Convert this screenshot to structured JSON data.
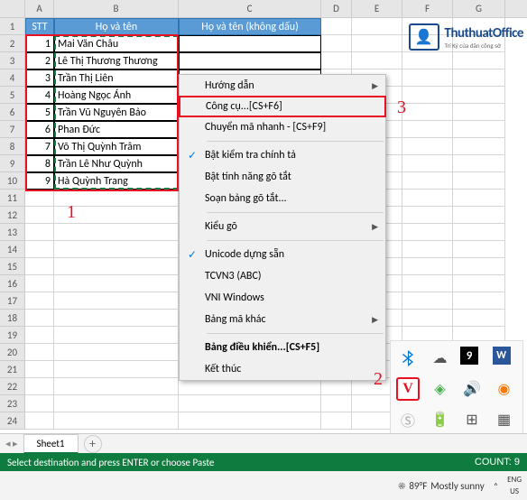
{
  "columns": [
    "A",
    "B",
    "C",
    "D",
    "E",
    "F",
    "G"
  ],
  "header": {
    "stt": "STT",
    "name": "Họ và tên",
    "name_nd": "Họ và tên (không dấu)"
  },
  "rows": [
    {
      "n": "1",
      "name": "Mai Văn Châu"
    },
    {
      "n": "2",
      "name": "Lê Thị Thương Thương"
    },
    {
      "n": "3",
      "name": "Trần Thị Liên"
    },
    {
      "n": "4",
      "name": "Hoàng Ngọc Ánh"
    },
    {
      "n": "5",
      "name": "Trần Vũ Nguyên Bảo"
    },
    {
      "n": "6",
      "name": "Phan Đức"
    },
    {
      "n": "7",
      "name": "Võ Thị Quỳnh Trâm"
    },
    {
      "n": "8",
      "name": "Trần Lê Như Quỳnh"
    },
    {
      "n": "9",
      "name": "Hà Quỳnh Trang"
    }
  ],
  "row_numbers": [
    "1",
    "2",
    "3",
    "4",
    "5",
    "6",
    "7",
    "8",
    "9",
    "10",
    "11",
    "12",
    "13",
    "14",
    "15",
    "16",
    "17",
    "18",
    "19",
    "20",
    "21",
    "22",
    "23",
    "24"
  ],
  "logo": {
    "title": "ThuthuatOffice",
    "sub": "Trí Kỷ của dân công sở"
  },
  "menu": {
    "items": [
      {
        "label": "Hướng dẫn",
        "arrow": true
      },
      {
        "label": "Công cụ...[CS+F6]",
        "highlight": true
      },
      {
        "label": "Chuyển mã nhanh - [CS+F9]"
      },
      {
        "sep": true
      },
      {
        "label": "Bật kiểm tra chính tả",
        "check": true
      },
      {
        "label": "Bật tính năng gõ tắt"
      },
      {
        "label": "Soạn bảng gõ tắt..."
      },
      {
        "sep": true
      },
      {
        "label": "Kiểu gõ",
        "arrow": true
      },
      {
        "sep": true
      },
      {
        "label": "Unicode dựng sẵn",
        "check": true
      },
      {
        "label": "TCVN3 (ABC)"
      },
      {
        "label": "VNI Windows"
      },
      {
        "label": "Bảng mã khác",
        "arrow": true
      },
      {
        "sep": true
      },
      {
        "label": "Bảng điều khiển...[CS+F5]",
        "bold": true
      },
      {
        "label": "Kết thúc"
      }
    ]
  },
  "annotations": {
    "a1": "1",
    "a2": "2",
    "a3": "3"
  },
  "sheet": {
    "tab": "Sheet1"
  },
  "status": {
    "left": "Select destination and press ENTER or choose Paste",
    "right": "COUNT: 9"
  },
  "taskbar": {
    "temp": "89°F",
    "weather": "Mostly sunny",
    "lang": "ENG",
    "locale": "US"
  },
  "tray_v": "V"
}
